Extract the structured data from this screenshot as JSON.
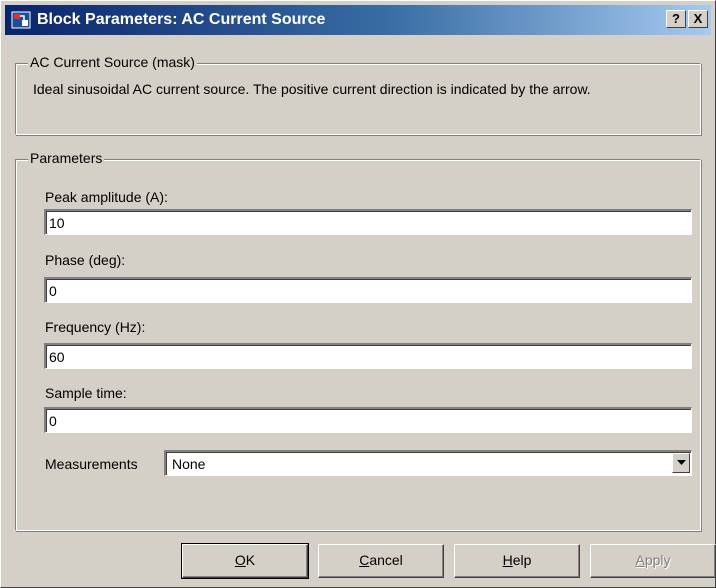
{
  "window": {
    "title": "Block Parameters: AC Current Source",
    "help_button": "?",
    "close_button": "X"
  },
  "mask_group": {
    "legend": "AC Current Source (mask)",
    "description": "Ideal sinusoidal AC current source. The positive current direction is indicated by the arrow."
  },
  "parameters": {
    "legend": "Parameters",
    "fields": [
      {
        "label": "Peak amplitude (A):",
        "value": "10"
      },
      {
        "label": "Phase (deg):",
        "value": "0"
      },
      {
        "label": "Frequency (Hz):",
        "value": "60"
      },
      {
        "label": "Sample time:",
        "value": "0"
      }
    ],
    "measurements": {
      "label": "Measurements",
      "selected": "None"
    }
  },
  "buttons": {
    "ok": {
      "mnemonic": "O",
      "rest": "K"
    },
    "cancel": {
      "mnemonic": "C",
      "rest": "ancel"
    },
    "help": {
      "mnemonic": "H",
      "rest": "elp"
    },
    "apply": {
      "mnemonic": "A",
      "rest": "pply"
    }
  },
  "colors": {
    "titlebar_start": "#0a246a",
    "titlebar_end": "#a6caf0",
    "face": "#d4d0c8"
  },
  "icons": {
    "title": "simulink-block-icon",
    "dropdown": "chevron-down-icon"
  }
}
